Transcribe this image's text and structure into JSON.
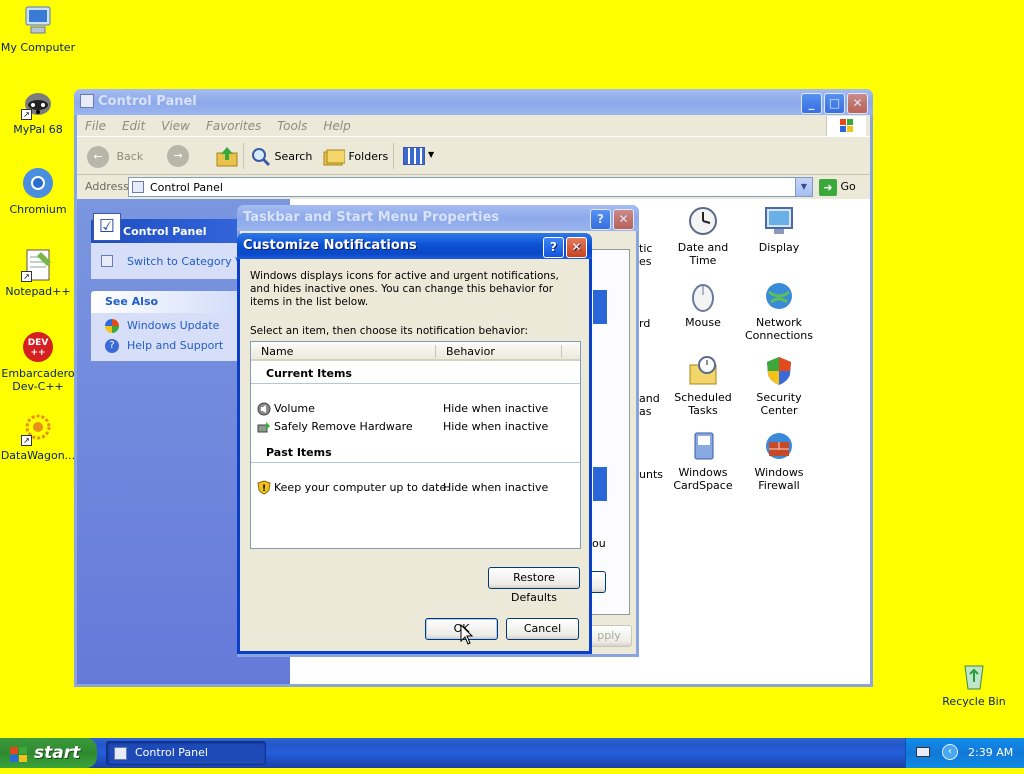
{
  "desktop": {
    "icons": [
      {
        "label": "My Computer"
      },
      {
        "label": "MyPal 68"
      },
      {
        "label": "Chromium"
      },
      {
        "label": "Notepad++"
      },
      {
        "label": "Embarcadero Dev-C++"
      },
      {
        "label": "DataWagon..."
      },
      {
        "label": "Recycle Bin"
      }
    ]
  },
  "control_panel": {
    "title": "Control Panel",
    "menu": [
      "File",
      "Edit",
      "View",
      "Favorites",
      "Tools",
      "Help"
    ],
    "toolbar": {
      "back": "Back",
      "search": "Search",
      "folders": "Folders"
    },
    "address_label": "Address",
    "address_value": "Control Panel",
    "go_label": "Go",
    "sidebar": {
      "panel_title": "Control Panel",
      "switch_link": "Switch to Category View",
      "see_also_title": "See Also",
      "see_also": [
        "Windows Update",
        "Help and Support"
      ]
    },
    "items": [
      {
        "label": "Date and Time",
        "icon": "clock-icon"
      },
      {
        "label": "Display",
        "icon": "display-icon"
      },
      {
        "label": "Mouse",
        "icon": "mouse-icon"
      },
      {
        "label": "Network Connections",
        "icon": "network-icon"
      },
      {
        "label": "Scheduled Tasks",
        "icon": "scheduled-tasks-icon"
      },
      {
        "label": "Security Center",
        "icon": "shield-icon"
      },
      {
        "label": "Windows CardSpace",
        "icon": "cardspace-icon"
      },
      {
        "label": "Windows Firewall",
        "icon": "firewall-icon"
      }
    ],
    "partial_items": [
      "tic",
      "es",
      "rd",
      "and",
      "as",
      "unts"
    ]
  },
  "taskbar_props": {
    "title": "Taskbar and Start Menu Properties",
    "partial_text": "ou",
    "apply_partial": "pply"
  },
  "customize": {
    "title": "Customize Notifications",
    "description": "Windows displays icons for active and urgent notifications, and hides inactive ones. You can change this behavior for items in the list below.",
    "instruction": "Select an item, then choose its notification behavior:",
    "columns": [
      "Name",
      "Behavior"
    ],
    "current_header": "Current Items",
    "current_items": [
      {
        "name": "Volume",
        "behavior": "Hide when inactive",
        "icon": "speaker-icon"
      },
      {
        "name": "Safely Remove Hardware",
        "behavior": "Hide when inactive",
        "icon": "hardware-icon"
      }
    ],
    "past_header": "Past Items",
    "past_items": [
      {
        "name": "Keep your computer up to date.",
        "behavior": "Hide when inactive",
        "icon": "security-shield-icon"
      }
    ],
    "restore_label": "Restore Defaults",
    "ok_label": "OK",
    "cancel_label": "Cancel"
  },
  "taskbar": {
    "start_label": "start",
    "tasks": [
      "Control Panel"
    ],
    "clock": "2:39 AM"
  },
  "colors": {
    "desktop": "#ffff00",
    "title_blue": "#0b52d6",
    "sidebar_blue": "#7a96df"
  }
}
